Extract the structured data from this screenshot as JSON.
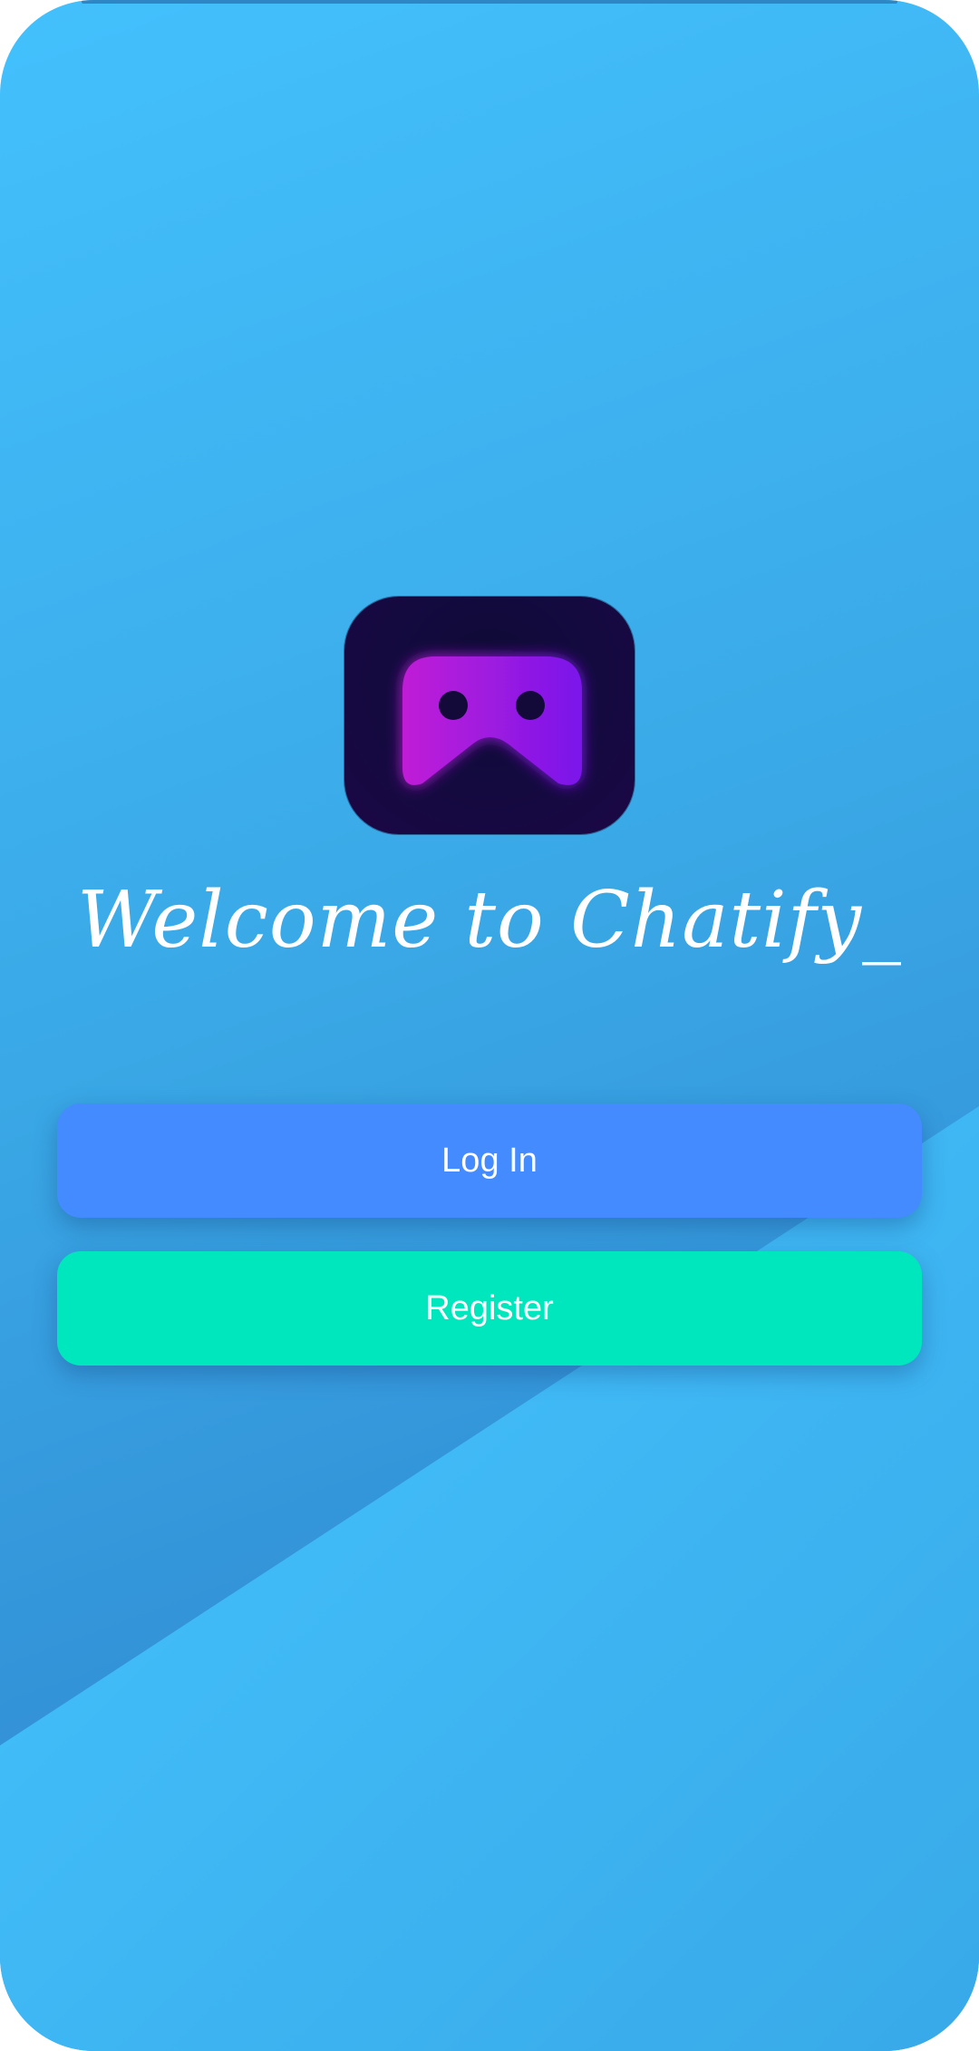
{
  "welcome": {
    "title": "Welcome to Chatify_"
  },
  "buttons": {
    "login_label": "Log In",
    "register_label": "Register"
  },
  "colors": {
    "background_light": "#43c1fd",
    "background_dark": "#318fd6",
    "login_button": "#448bff",
    "register_button": "#00e7bd",
    "logo_bg": "#130a3f",
    "logo_mask_start": "#c01fd6",
    "logo_mask_end": "#7a16ea"
  },
  "icons": {
    "logo": "mask-logo-icon"
  }
}
